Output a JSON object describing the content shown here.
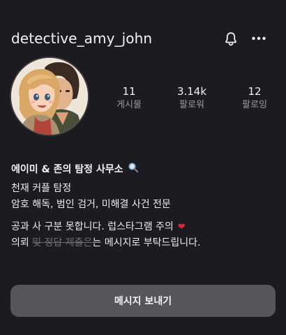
{
  "header": {
    "username": "detective_amy_john",
    "icons": [
      "bell-icon",
      "more-icon"
    ]
  },
  "stats": [
    {
      "value": "11",
      "label": "게시물"
    },
    {
      "value": "3.14k",
      "label": "팔로워"
    },
    {
      "value": "12",
      "label": "팔로잉"
    }
  ],
  "bio": {
    "name": "에이미 & 존의 탐정 사무소",
    "name_icon": "magnifier-icon",
    "line1": "천재 커플 탐정",
    "line2": "암호 해독, 범인 검거, 미해결 사건 전문",
    "line3": "공과 사 구분 못합니다. 럽스타그램 주의",
    "line4_prefix": "의뢰 ",
    "line4_struck": "및 정답 제출은",
    "line4_suffix": "는 메시지로 부탁드립니다."
  },
  "actions": {
    "message_label": "메시지 보내기"
  },
  "colors": {
    "background": "#1c1b20",
    "button": "#55555a",
    "heart": "#e0283a"
  }
}
